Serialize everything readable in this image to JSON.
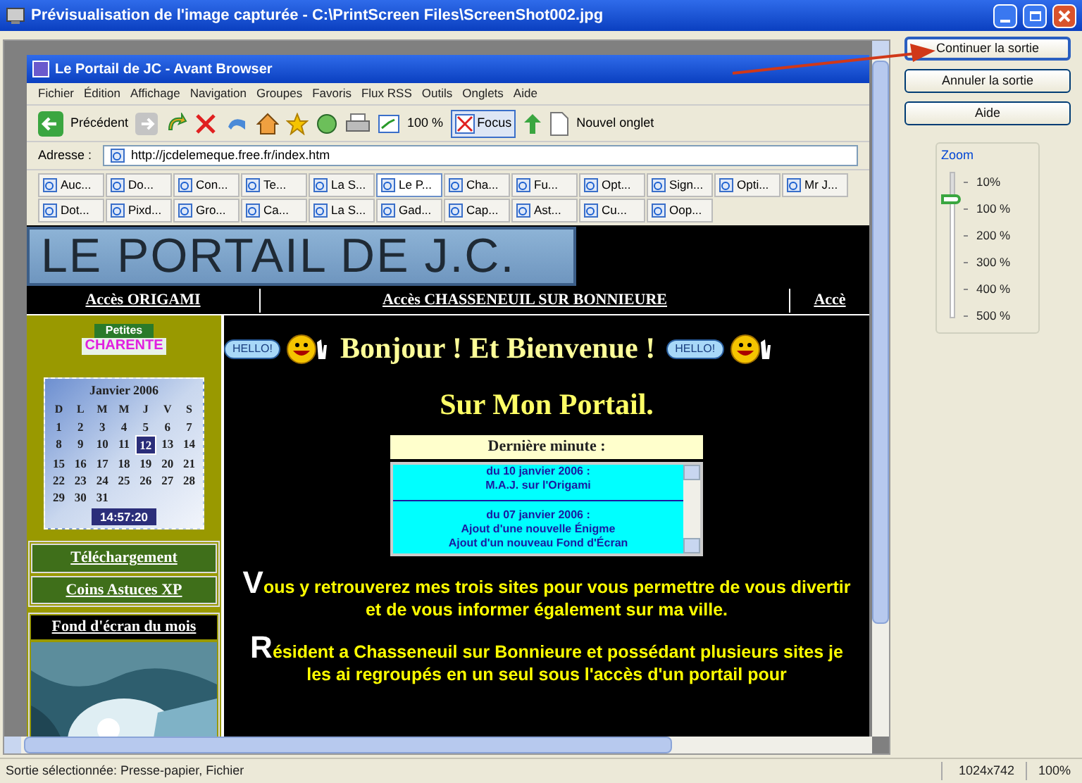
{
  "window": {
    "title": "Prévisualisation de l'image capturée - C:\\PrintScreen Files\\ScreenShot002.jpg"
  },
  "actions": [
    {
      "label": "Continuer la sortie",
      "selected": true
    },
    {
      "label": "Annuler la sortie",
      "selected": false
    },
    {
      "label": "Aide",
      "selected": false
    }
  ],
  "zoom": {
    "label": "Zoom",
    "level": 0.2,
    "levels": [
      "10%",
      "100 %",
      "200 %",
      "300 %",
      "400 %",
      "500 %"
    ]
  },
  "status_bar": {
    "output": "Sortie sélectionnée:  Presse-papier, Fichier",
    "size": "1024x742",
    "zoom": "100%"
  },
  "browser": {
    "title": "Le Portail de JC - Avant Browser",
    "menu": [
      "Fichier",
      "Édition",
      "Affichage",
      "Navigation",
      "Groupes",
      "Favoris",
      "Flux RSS",
      "Outils",
      "Onglets",
      "Aide"
    ],
    "toolbar": {
      "back": "Précédent",
      "zoom": "100 %",
      "focus": "Focus",
      "new_tab": "Nouvel onglet"
    },
    "address": {
      "label": "Adresse :",
      "value": "http://jcdelemeque.free.fr/index.htm"
    },
    "tab_rows": [
      [
        {
          "label": "Auc...",
          "selected": false
        },
        {
          "label": "Do...",
          "selected": false
        },
        {
          "label": "Con...",
          "selected": false
        },
        {
          "label": "Te...",
          "selected": false
        },
        {
          "label": "La S...",
          "selected": false
        },
        {
          "label": "Le P...",
          "selected": true
        },
        {
          "label": "Cha...",
          "selected": false
        },
        {
          "label": "Fu...",
          "selected": false
        },
        {
          "label": "Opt...",
          "selected": false
        },
        {
          "label": "Sign...",
          "selected": false
        },
        {
          "label": "Opti...",
          "selected": false
        },
        {
          "label": "Mr J...",
          "selected": false
        }
      ],
      [
        {
          "label": "Dot...",
          "selected": false
        },
        {
          "label": "Pixd...",
          "selected": false
        },
        {
          "label": "Gro...",
          "selected": false
        },
        {
          "label": "Ca...",
          "selected": false
        },
        {
          "label": "La S...",
          "selected": false
        },
        {
          "label": "Gad...",
          "selected": false
        },
        {
          "label": "Cap...",
          "selected": false
        },
        {
          "label": "Ast...",
          "selected": false
        },
        {
          "label": "Cu...",
          "selected": false
        },
        {
          "label": "Oop...",
          "selected": false
        }
      ]
    ]
  },
  "page": {
    "banner": "LE PORTAIL DE J.C.",
    "nav": [
      "Accès ORIGAMI",
      "Accès  CHASSENEUIL SUR BONNIEURE",
      "Accè"
    ],
    "sidebar": {
      "logo_top": "Petites",
      "logo_bottom": "CHARENTE",
      "calendar": {
        "title": "Janvier 2006",
        "weekdays": [
          "D",
          "L",
          "M",
          "M",
          "J",
          "V",
          "S"
        ],
        "weeks": [
          [
            {
              "day": "1",
              "selected": false
            },
            {
              "day": "2",
              "selected": false
            },
            {
              "day": "3",
              "selected": false
            },
            {
              "day": "4",
              "selected": false
            },
            {
              "day": "5",
              "selected": false
            },
            {
              "day": "6",
              "selected": false
            },
            {
              "day": "7",
              "selected": false
            }
          ],
          [
            {
              "day": "8",
              "selected": false
            },
            {
              "day": "9",
              "selected": false
            },
            {
              "day": "10",
              "selected": false
            },
            {
              "day": "11",
              "selected": false
            },
            {
              "day": "12",
              "selected": true
            },
            {
              "day": "13",
              "selected": false
            },
            {
              "day": "14",
              "selected": false
            }
          ],
          [
            {
              "day": "15",
              "selected": false
            },
            {
              "day": "16",
              "selected": false
            },
            {
              "day": "17",
              "selected": false
            },
            {
              "day": "18",
              "selected": false
            },
            {
              "day": "19",
              "selected": false
            },
            {
              "day": "20",
              "selected": false
            },
            {
              "day": "21",
              "selected": false
            }
          ],
          [
            {
              "day": "22",
              "selected": false
            },
            {
              "day": "23",
              "selected": false
            },
            {
              "day": "24",
              "selected": false
            },
            {
              "day": "25",
              "selected": false
            },
            {
              "day": "26",
              "selected": false
            },
            {
              "day": "27",
              "selected": false
            },
            {
              "day": "28",
              "selected": false
            }
          ],
          [
            {
              "day": "29",
              "selected": false
            },
            {
              "day": "30",
              "selected": false
            },
            {
              "day": "31",
              "selected": false
            }
          ]
        ],
        "time": "14:57:20"
      },
      "links": [
        "Téléchargement",
        "Coins Astuces XP"
      ],
      "wallpaper_heading": "Fond d'écran du mois"
    },
    "hello_badges": [
      "HELLO!",
      "HELLO!"
    ],
    "heading": "Bonjour ! Et Bienvenue !",
    "subheading": "Sur Mon Portail.",
    "news": {
      "title": "Dernière minute :",
      "items": [
        {
          "date": "du 10 janvier 2006 :",
          "lines": [
            "M.A.J. sur l'Origami"
          ]
        },
        {
          "date": "du 07 janvier 2006 :",
          "lines": [
            "Ajout d'une nouvelle Énigme",
            "Ajout d'un nouveau Fond d'Écran"
          ]
        }
      ]
    },
    "paragraphs": [
      {
        "initial": "V",
        "text": "ous y retrouverez mes trois sites pour vous permettre de vous divertir et de vous informer également sur ma ville."
      },
      {
        "initial": "R",
        "text": "ésident a Chasseneuil sur Bonnieure et possédant plusieurs sites je les ai regroupés en un seul sous l'accès d'un portail pour"
      }
    ]
  }
}
